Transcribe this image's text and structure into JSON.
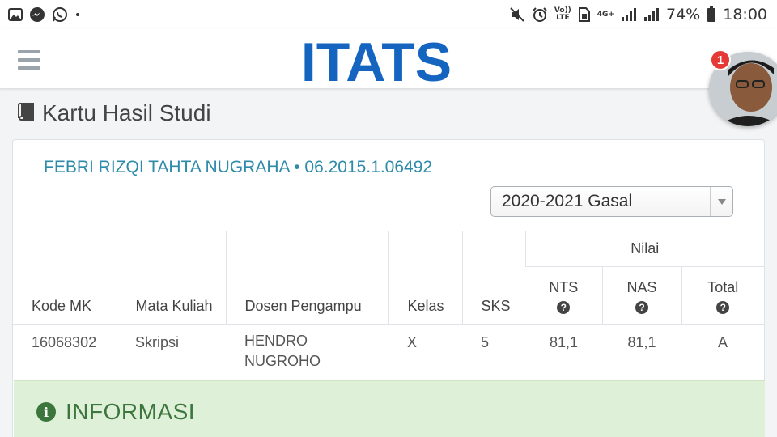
{
  "statusbar": {
    "lte_label": "LTE",
    "volte_label": "Vo))",
    "network": "4G+",
    "battery": "74%",
    "time": "18:00"
  },
  "header": {
    "logo_text": "ITATS",
    "brand_color": "#1565c0",
    "notification_count": "1"
  },
  "page": {
    "title": "Kartu Hasil Studi",
    "title_icon": "book-icon"
  },
  "student": {
    "name_id": "FEBRI RIZQI TAHTA NUGRAHA • 06.2015.1.06492"
  },
  "semester_select": {
    "selected": "2020-2021 Gasal"
  },
  "table": {
    "group_header": "Nilai",
    "columns": {
      "kode": "Kode MK",
      "mata_kuliah": "Mata Kuliah",
      "dosen": "Dosen Pengampu",
      "kelas": "Kelas",
      "sks": "SKS",
      "nts": "NTS",
      "nas": "NAS",
      "total": "Total"
    },
    "help_icon": "?",
    "rows": [
      {
        "kode": "16068302",
        "mata_kuliah": "Skripsi",
        "dosen": "HENDRO NUGROHO",
        "kelas": "X",
        "sks": "5",
        "nts": "81,1",
        "nas": "81,1",
        "total": "A"
      }
    ]
  },
  "info": {
    "title": "INFORMASI",
    "icon": "info-icon"
  }
}
